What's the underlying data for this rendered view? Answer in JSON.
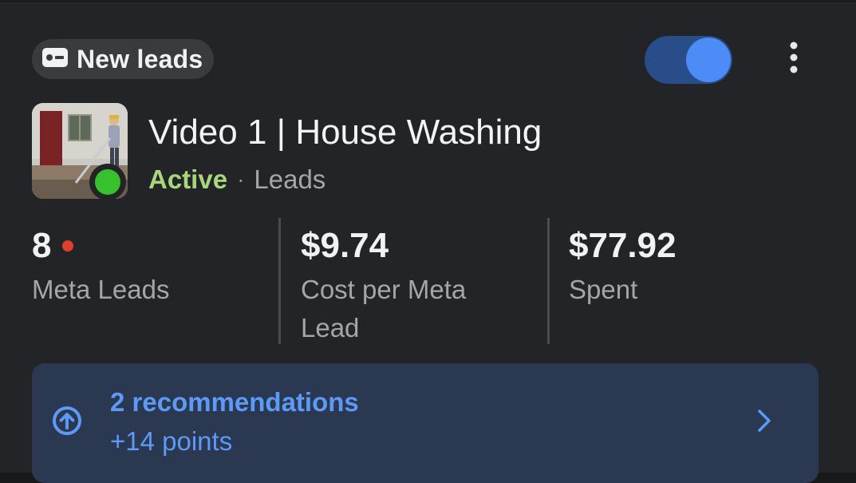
{
  "chip": {
    "label": "New leads",
    "icon": "lead-form-icon"
  },
  "toggle": {
    "state": "on",
    "color": "#4b8cf7"
  },
  "menu": {
    "icon": "more-vertical-icon"
  },
  "ad": {
    "title": "Video 1 | House Washing",
    "status": "Active",
    "separator": "·",
    "objective": "Leads",
    "status_color": "#35c22c"
  },
  "metrics": [
    {
      "value": "8",
      "label": "Meta Leads"
    },
    {
      "value": "$9.74",
      "label": "Cost per Meta Lead"
    },
    {
      "value": "$77.92",
      "label": "Spent"
    }
  ],
  "recommendations": {
    "title": "2 recommendations",
    "subtitle": "+14 points",
    "icon": "arrow-up-circle-icon",
    "chevron": "chevron-right-icon"
  }
}
